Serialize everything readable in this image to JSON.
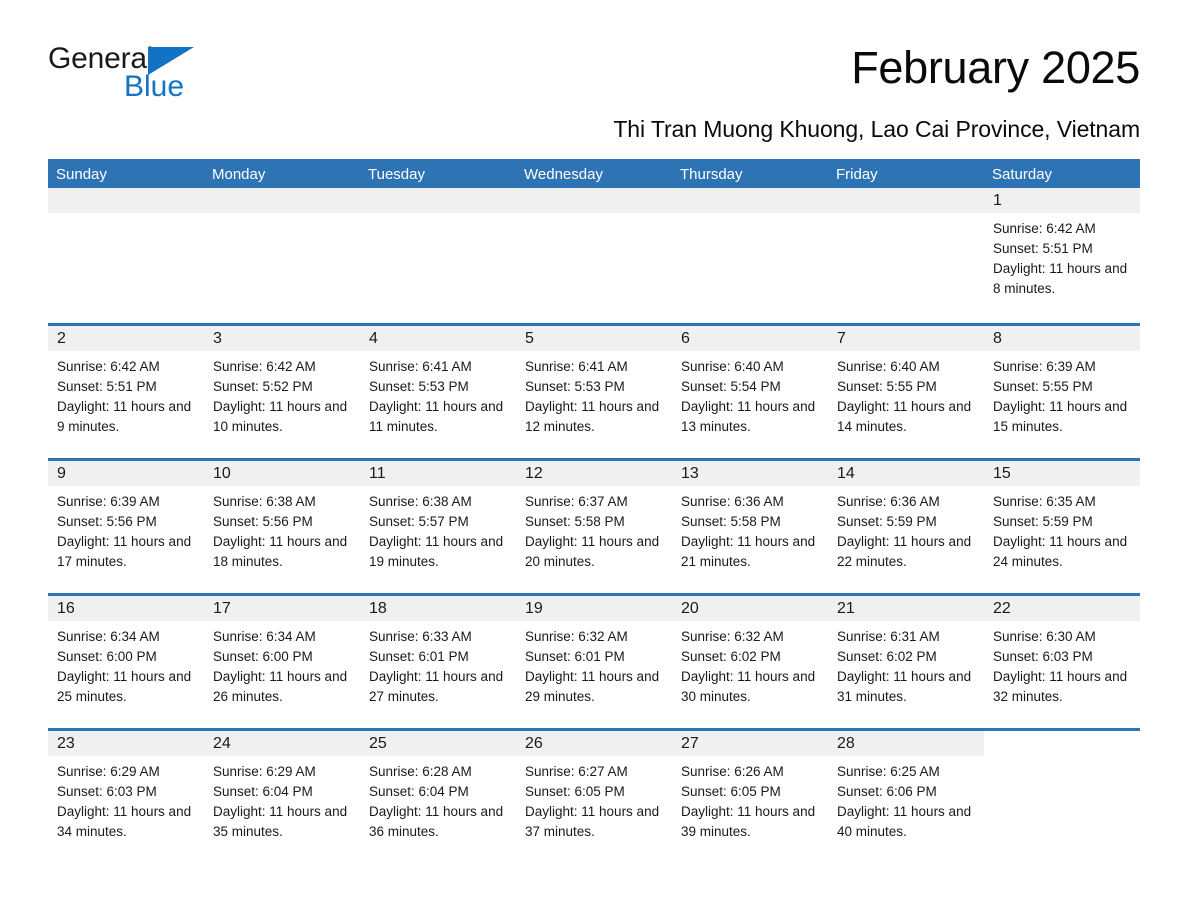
{
  "brand": {
    "name_part1": "General",
    "name_part2": "Blue",
    "logo_icon": "triangle-flag-icon",
    "accent_color": "#1272c4"
  },
  "header": {
    "title": "February 2025",
    "location": "Thi Tran Muong Khuong, Lao Cai Province, Vietnam"
  },
  "theme": {
    "header_blue": "#2e74b5",
    "band_gray": "#f0f0f0",
    "text_color": "#1a1a1a"
  },
  "calendar": {
    "weekdays": [
      "Sunday",
      "Monday",
      "Tuesday",
      "Wednesday",
      "Thursday",
      "Friday",
      "Saturday"
    ],
    "weeks": [
      [
        {
          "day": "",
          "empty": true
        },
        {
          "day": "",
          "empty": true
        },
        {
          "day": "",
          "empty": true
        },
        {
          "day": "",
          "empty": true
        },
        {
          "day": "",
          "empty": true
        },
        {
          "day": "",
          "empty": true
        },
        {
          "day": "1",
          "sunrise": "Sunrise: 6:42 AM",
          "sunset": "Sunset: 5:51 PM",
          "daylight": "Daylight: 11 hours and 8 minutes."
        }
      ],
      [
        {
          "day": "2",
          "sunrise": "Sunrise: 6:42 AM",
          "sunset": "Sunset: 5:51 PM",
          "daylight": "Daylight: 11 hours and 9 minutes."
        },
        {
          "day": "3",
          "sunrise": "Sunrise: 6:42 AM",
          "sunset": "Sunset: 5:52 PM",
          "daylight": "Daylight: 11 hours and 10 minutes."
        },
        {
          "day": "4",
          "sunrise": "Sunrise: 6:41 AM",
          "sunset": "Sunset: 5:53 PM",
          "daylight": "Daylight: 11 hours and 11 minutes."
        },
        {
          "day": "5",
          "sunrise": "Sunrise: 6:41 AM",
          "sunset": "Sunset: 5:53 PM",
          "daylight": "Daylight: 11 hours and 12 minutes."
        },
        {
          "day": "6",
          "sunrise": "Sunrise: 6:40 AM",
          "sunset": "Sunset: 5:54 PM",
          "daylight": "Daylight: 11 hours and 13 minutes."
        },
        {
          "day": "7",
          "sunrise": "Sunrise: 6:40 AM",
          "sunset": "Sunset: 5:55 PM",
          "daylight": "Daylight: 11 hours and 14 minutes."
        },
        {
          "day": "8",
          "sunrise": "Sunrise: 6:39 AM",
          "sunset": "Sunset: 5:55 PM",
          "daylight": "Daylight: 11 hours and 15 minutes."
        }
      ],
      [
        {
          "day": "9",
          "sunrise": "Sunrise: 6:39 AM",
          "sunset": "Sunset: 5:56 PM",
          "daylight": "Daylight: 11 hours and 17 minutes."
        },
        {
          "day": "10",
          "sunrise": "Sunrise: 6:38 AM",
          "sunset": "Sunset: 5:56 PM",
          "daylight": "Daylight: 11 hours and 18 minutes."
        },
        {
          "day": "11",
          "sunrise": "Sunrise: 6:38 AM",
          "sunset": "Sunset: 5:57 PM",
          "daylight": "Daylight: 11 hours and 19 minutes."
        },
        {
          "day": "12",
          "sunrise": "Sunrise: 6:37 AM",
          "sunset": "Sunset: 5:58 PM",
          "daylight": "Daylight: 11 hours and 20 minutes."
        },
        {
          "day": "13",
          "sunrise": "Sunrise: 6:36 AM",
          "sunset": "Sunset: 5:58 PM",
          "daylight": "Daylight: 11 hours and 21 minutes."
        },
        {
          "day": "14",
          "sunrise": "Sunrise: 6:36 AM",
          "sunset": "Sunset: 5:59 PM",
          "daylight": "Daylight: 11 hours and 22 minutes."
        },
        {
          "day": "15",
          "sunrise": "Sunrise: 6:35 AM",
          "sunset": "Sunset: 5:59 PM",
          "daylight": "Daylight: 11 hours and 24 minutes."
        }
      ],
      [
        {
          "day": "16",
          "sunrise": "Sunrise: 6:34 AM",
          "sunset": "Sunset: 6:00 PM",
          "daylight": "Daylight: 11 hours and 25 minutes."
        },
        {
          "day": "17",
          "sunrise": "Sunrise: 6:34 AM",
          "sunset": "Sunset: 6:00 PM",
          "daylight": "Daylight: 11 hours and 26 minutes."
        },
        {
          "day": "18",
          "sunrise": "Sunrise: 6:33 AM",
          "sunset": "Sunset: 6:01 PM",
          "daylight": "Daylight: 11 hours and 27 minutes."
        },
        {
          "day": "19",
          "sunrise": "Sunrise: 6:32 AM",
          "sunset": "Sunset: 6:01 PM",
          "daylight": "Daylight: 11 hours and 29 minutes."
        },
        {
          "day": "20",
          "sunrise": "Sunrise: 6:32 AM",
          "sunset": "Sunset: 6:02 PM",
          "daylight": "Daylight: 11 hours and 30 minutes."
        },
        {
          "day": "21",
          "sunrise": "Sunrise: 6:31 AM",
          "sunset": "Sunset: 6:02 PM",
          "daylight": "Daylight: 11 hours and 31 minutes."
        },
        {
          "day": "22",
          "sunrise": "Sunrise: 6:30 AM",
          "sunset": "Sunset: 6:03 PM",
          "daylight": "Daylight: 11 hours and 32 minutes."
        }
      ],
      [
        {
          "day": "23",
          "sunrise": "Sunrise: 6:29 AM",
          "sunset": "Sunset: 6:03 PM",
          "daylight": "Daylight: 11 hours and 34 minutes."
        },
        {
          "day": "24",
          "sunrise": "Sunrise: 6:29 AM",
          "sunset": "Sunset: 6:04 PM",
          "daylight": "Daylight: 11 hours and 35 minutes."
        },
        {
          "day": "25",
          "sunrise": "Sunrise: 6:28 AM",
          "sunset": "Sunset: 6:04 PM",
          "daylight": "Daylight: 11 hours and 36 minutes."
        },
        {
          "day": "26",
          "sunrise": "Sunrise: 6:27 AM",
          "sunset": "Sunset: 6:05 PM",
          "daylight": "Daylight: 11 hours and 37 minutes."
        },
        {
          "day": "27",
          "sunrise": "Sunrise: 6:26 AM",
          "sunset": "Sunset: 6:05 PM",
          "daylight": "Daylight: 11 hours and 39 minutes."
        },
        {
          "day": "28",
          "sunrise": "Sunrise: 6:25 AM",
          "sunset": "Sunset: 6:06 PM",
          "daylight": "Daylight: 11 hours and 40 minutes."
        },
        {
          "day": "",
          "empty": true,
          "blank": true
        }
      ]
    ]
  }
}
